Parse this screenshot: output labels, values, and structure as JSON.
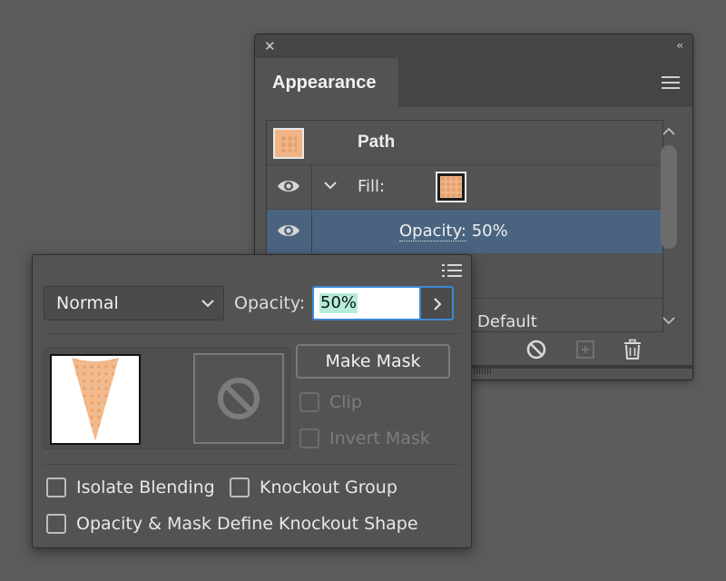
{
  "appearance_panel": {
    "tab_title": "Appearance",
    "rows": {
      "path_label": "Path",
      "fill_label": "Fill:",
      "opacity_key": "Opacity:",
      "opacity_value": "50%",
      "default_label": "Default"
    },
    "icons": {
      "close": "close-icon",
      "collapse": "collapse-double-chevron-icon",
      "menu": "hamburger-menu-icon",
      "eye": "eye-icon",
      "disclosure": "chevron-down-icon",
      "clear": "no-sign-icon",
      "duplicate": "duplicate-item-icon",
      "delete": "trash-icon"
    },
    "selected_row_color": "#4a6480",
    "swatch_color": "#f0b486"
  },
  "transparency_panel": {
    "blend_mode": "Normal",
    "opacity_label": "Opacity:",
    "opacity_value": "50%",
    "make_mask_label": "Make Mask",
    "clip_label": "Clip",
    "invert_mask_label": "Invert Mask",
    "isolate_blending_label": "Isolate Blending",
    "knockout_group_label": "Knockout Group",
    "opacity_mask_knockout_label": "Opacity & Mask Define Knockout Shape",
    "checkbox_states": {
      "clip": false,
      "invert_mask": false,
      "isolate_blending": false,
      "knockout_group": false,
      "opacity_mask_knockout": false
    },
    "icons": {
      "menu": "list-menu-icon",
      "select_arrow": "chevron-down-icon",
      "opacity_arrow": "chevron-right-icon",
      "no_mask": "no-sign-icon"
    },
    "input_focus_color": "#3b88d6"
  }
}
